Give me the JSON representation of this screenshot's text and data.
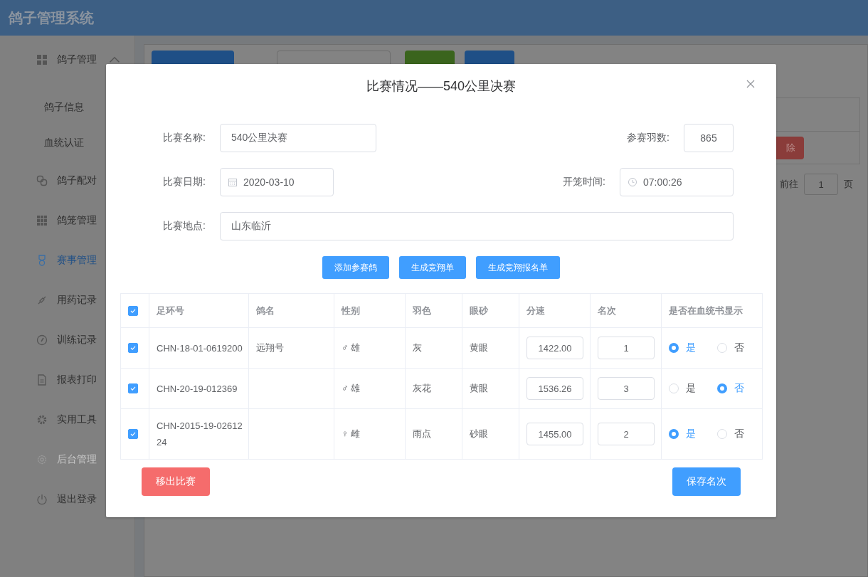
{
  "header": {
    "title": "鸽子管理系统"
  },
  "sidebar": {
    "items": [
      {
        "label": "鸽子管理",
        "selected": false,
        "disabled": false,
        "expanded": true,
        "children": [
          {
            "label": "鸽子信息",
            "selected": false
          },
          {
            "label": "血统认证",
            "selected": false
          }
        ]
      },
      {
        "label": "鸽子配对",
        "selected": false,
        "disabled": false
      },
      {
        "label": "鸽笼管理",
        "selected": false,
        "disabled": false
      },
      {
        "label": "赛事管理",
        "selected": true,
        "disabled": false
      },
      {
        "label": "用药记录",
        "selected": false,
        "disabled": false
      },
      {
        "label": "训练记录",
        "selected": false,
        "disabled": false
      },
      {
        "label": "报表打印",
        "selected": false,
        "disabled": false
      },
      {
        "label": "实用工具",
        "selected": false,
        "disabled": false
      },
      {
        "label": "后台管理",
        "selected": false,
        "disabled": true
      },
      {
        "label": "退出登录",
        "selected": false,
        "disabled": false
      }
    ]
  },
  "list": {
    "delete_button": "除",
    "pagination": {
      "goto_label": "前往",
      "page": "1",
      "suffix": "页"
    }
  },
  "dialog": {
    "title": "比赛情况——540公里决赛",
    "form": {
      "race_name": {
        "label": "比赛名称:",
        "value": "540公里决赛"
      },
      "entries": {
        "label": "参赛羽数:",
        "value": "865"
      },
      "date": {
        "label": "比赛日期:",
        "value": "2020-03-10"
      },
      "release_time": {
        "label": "开笼时间:",
        "value": "07:00:26"
      },
      "location": {
        "label": "比赛地点:",
        "value": "山东临沂"
      }
    },
    "actions": [
      "添加参赛鸽",
      "生成竞翔单",
      "生成竞翔报名单"
    ],
    "table": {
      "all_checked": true,
      "columns": [
        "足环号",
        "鸽名",
        "性别",
        "羽色",
        "眼砂",
        "分速",
        "名次",
        "是否在血统书显示"
      ],
      "rows": [
        {
          "checked": true,
          "ring": "CHN-18-01-0619200",
          "name": "远翔号",
          "sex": "♂ 雄",
          "plumage": "灰",
          "eye": "黄眼",
          "speed": "1422.00",
          "rank": "1",
          "show": [
            {
              "label": "是",
              "selected": true
            },
            {
              "label": "否",
              "selected": false
            }
          ]
        },
        {
          "checked": true,
          "ring": "CHN-20-19-012369",
          "sex": "♂ 雄",
          "plumage": "灰花",
          "eye": "黄眼",
          "speed": "1536.26",
          "rank": "3",
          "show": [
            {
              "label": "是",
              "selected": false
            },
            {
              "label": "否",
              "selected": true
            }
          ]
        },
        {
          "checked": true,
          "ring": "CHN-2015-19-0261224",
          "sex": "♀ 雌",
          "plumage": "雨点",
          "eye": "砂眼",
          "speed": "1455.00",
          "rank": "2",
          "show": [
            {
              "label": "是",
              "selected": true
            },
            {
              "label": "否",
              "selected": false
            }
          ]
        }
      ]
    },
    "remove_button": "移出比赛",
    "save_button": "保存名次"
  }
}
